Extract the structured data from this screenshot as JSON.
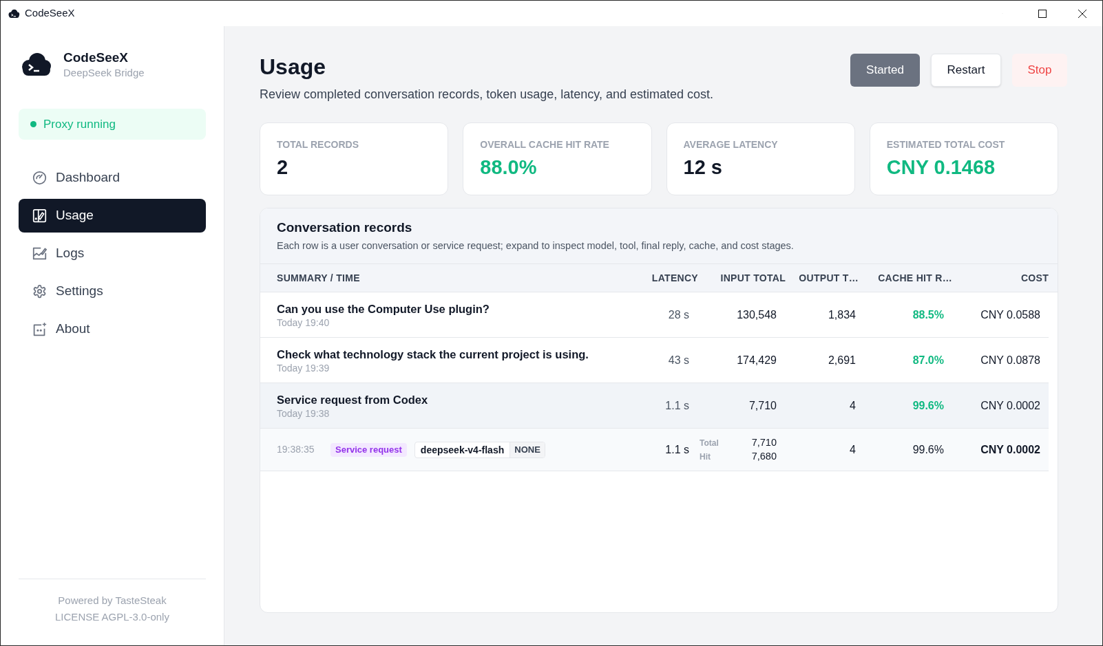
{
  "window": {
    "title": "CodeSeeX"
  },
  "sidebar": {
    "brand": {
      "name": "CodeSeeX",
      "subtitle": "DeepSeek Bridge"
    },
    "status": {
      "label": "Proxy running",
      "running": true
    },
    "nav": [
      {
        "label": "Dashboard",
        "selected": false
      },
      {
        "label": "Usage",
        "selected": true
      },
      {
        "label": "Logs",
        "selected": false
      },
      {
        "label": "Settings",
        "selected": false
      },
      {
        "label": "About",
        "selected": false
      }
    ],
    "footer": [
      "Powered by TasteSteak",
      "LICENSE AGPL-3.0-only"
    ]
  },
  "page": {
    "title": "Usage",
    "subtitle": "Review completed conversation records, token usage, latency, and estimated cost.",
    "buttons": [
      {
        "label": "Started",
        "kind": "primary"
      },
      {
        "label": "Restart",
        "kind": "secondary"
      },
      {
        "label": "Stop",
        "kind": "danger"
      }
    ]
  },
  "stats": [
    {
      "label": "TOTAL RECORDS",
      "value": "2",
      "color": "#111827"
    },
    {
      "label": "OVERALL CACHE HIT RATE",
      "value": "88.0%",
      "color": "#10b981"
    },
    {
      "label": "AVERAGE LATENCY",
      "value": "12 s",
      "color": "#111827"
    },
    {
      "label": "ESTIMATED TOTAL COST",
      "value": "CNY 0.1468",
      "color": "#10b981"
    }
  ],
  "records": {
    "title": "Conversation records",
    "description": "Each row is a user conversation or service request; expand to inspect model, tool, final reply, cache, and cost stages.",
    "columns": [
      "SUMMARY / TIME",
      "LATENCY",
      "INPUT TOTAL",
      "OUTPUT T…",
      "CACHE HIT R…",
      "COST"
    ],
    "rows": [
      {
        "title": "Can you use the Computer Use plugin?",
        "time": "Today 19:40",
        "latency": "28 s",
        "input_total": "130,548",
        "output_total": "1,834",
        "cache_hit_rate": "88.5%",
        "cost": "CNY 0.0588",
        "expanded": false
      },
      {
        "title": "Check what technology stack the current project is using.",
        "time": "Today 19:39",
        "latency": "43 s",
        "input_total": "174,429",
        "output_total": "2,691",
        "cache_hit_rate": "87.0%",
        "cost": "CNY 0.0878",
        "expanded": false
      },
      {
        "title": "Service request from Codex",
        "time": "Today 19:38",
        "latency": "1.1 s",
        "input_total": "7,710",
        "output_total": "4",
        "cache_hit_rate": "99.6%",
        "cost": "CNY 0.0002",
        "expanded": true,
        "stages": [
          {
            "time": "19:38:35",
            "type": "Service request",
            "model": "deepseek-v4-flash",
            "badge": "NONE",
            "latency": "1.1 s",
            "input": [
              {
                "label": "Total",
                "value": "7,710"
              },
              {
                "label": "Hit",
                "value": "7,680"
              }
            ],
            "output_total": "4",
            "cache_hit_rate": "99.6%",
            "cost": "CNY 0.0002"
          }
        ]
      }
    ]
  }
}
